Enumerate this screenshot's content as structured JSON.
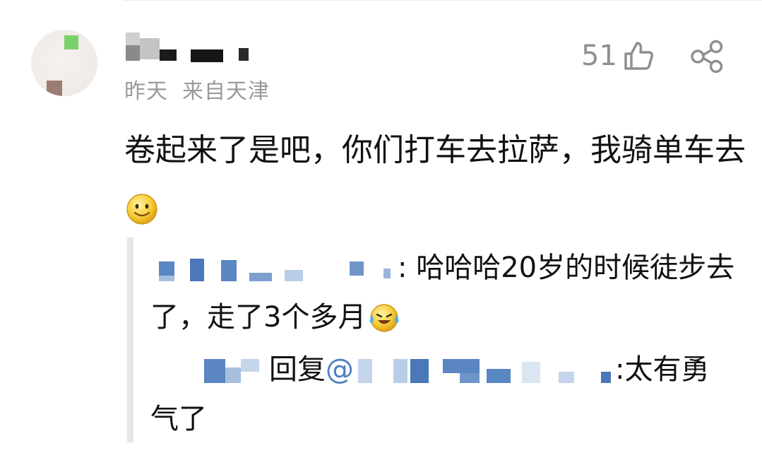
{
  "comment": {
    "time": "昨天",
    "location": "来自天津",
    "likes": "51",
    "text": "卷起来了是吧，你们打车去拉萨，我骑单车去",
    "emoji": "smile-emoji"
  },
  "replies": [
    {
      "sep": ":",
      "text": "哈哈哈20岁的时候徒步去了，走了3个多月",
      "emoji": "laugh-cry-emoji"
    },
    {
      "reply_word": "回复",
      "at": "@",
      "sep": ":",
      "text": "太有勇气了"
    }
  ],
  "colors": {
    "link": "#4f7fbf",
    "meta": "#9a9a9a",
    "icon": "#8f8f8f"
  }
}
